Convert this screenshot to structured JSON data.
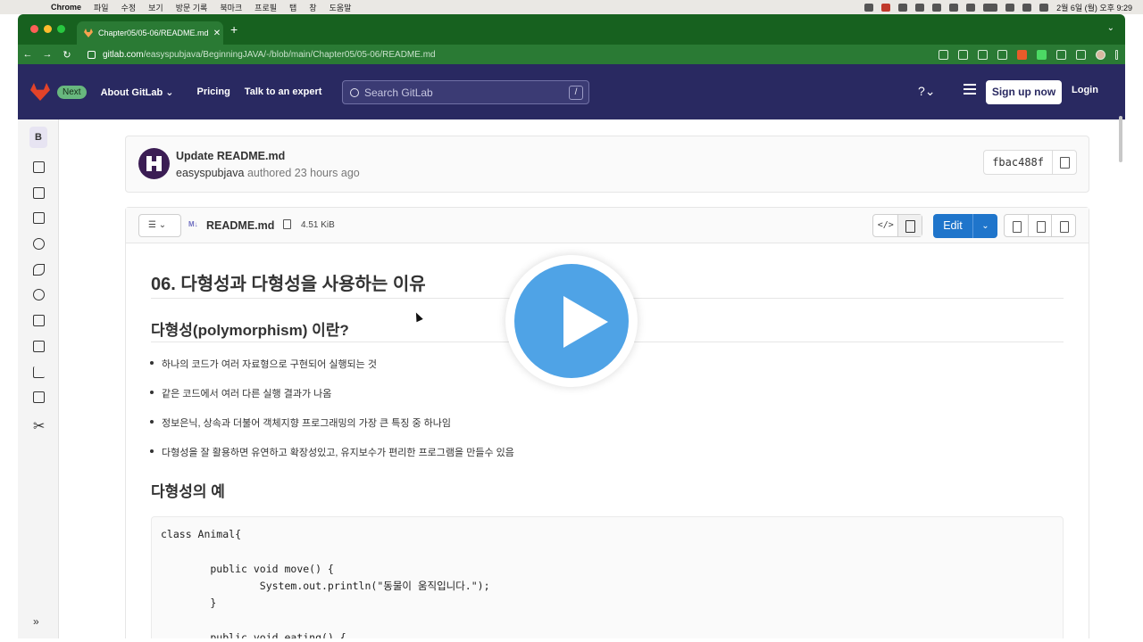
{
  "macos_menu_bar": {
    "app": "Chrome",
    "menus": [
      "파일",
      "수정",
      "보기",
      "방문 기록",
      "북마크",
      "프로필",
      "탭",
      "창",
      "도움말"
    ],
    "clock": "2월 6일 (월) 오후 9:29"
  },
  "browser": {
    "tab_title": "Chapter05/05-06/README.md",
    "url_host": "gitlab.com",
    "url_path": "/easyspubjava/BeginningJAVA/-/blob/main/Chapter05/05-06/README.md"
  },
  "gitlab_header": {
    "badge": "Next",
    "about": "About GitLab",
    "pricing": "Pricing",
    "talk": "Talk to an expert",
    "search_placeholder": "Search GitLab",
    "search_shortcut": "/",
    "signup": "Sign up now",
    "login": "Login"
  },
  "sidebar": {
    "avatar_letter": "B",
    "icons": [
      "project-overview-icon",
      "repository-icon",
      "issues-icon",
      "merge-requests-icon",
      "ci-cd-icon",
      "deployments-icon",
      "packages-icon",
      "monitor-icon",
      "analytics-icon",
      "wiki-icon",
      "snippets-icon"
    ]
  },
  "commit": {
    "title": "Update README.md",
    "author": "easyspubjava",
    "meta": "authored 23 hours ago",
    "sha": "fbac488f"
  },
  "file": {
    "name": "README.md",
    "md_badge": "M↓",
    "size": "4.51 KiB",
    "edit_label": "Edit"
  },
  "readme": {
    "h1": "06. 다형성과 다형성을 사용하는 이유",
    "h2_polymorphism": "다형성(polymorphism) 이란?",
    "bullets": [
      "하나의 코드가 여러 자료형으로 구현되어 실행되는 것",
      "같은 코드에서 여러 다른 실행 결과가 나옴",
      "정보은닉, 상속과 더불어 객체지향 프로그래밍의 가장 큰 특징 중 하나임",
      "다형성을 잘 활용하면 유연하고 확장성있고, 유지보수가 편리한 프로그램을 만들수 있음"
    ],
    "h2_example": "다형성의 예",
    "code": "class Animal{\n\n        public void move() {\n                System.out.println(\"동물이 움직입니다.\");\n        }\n\n        public void eating() {"
  }
}
